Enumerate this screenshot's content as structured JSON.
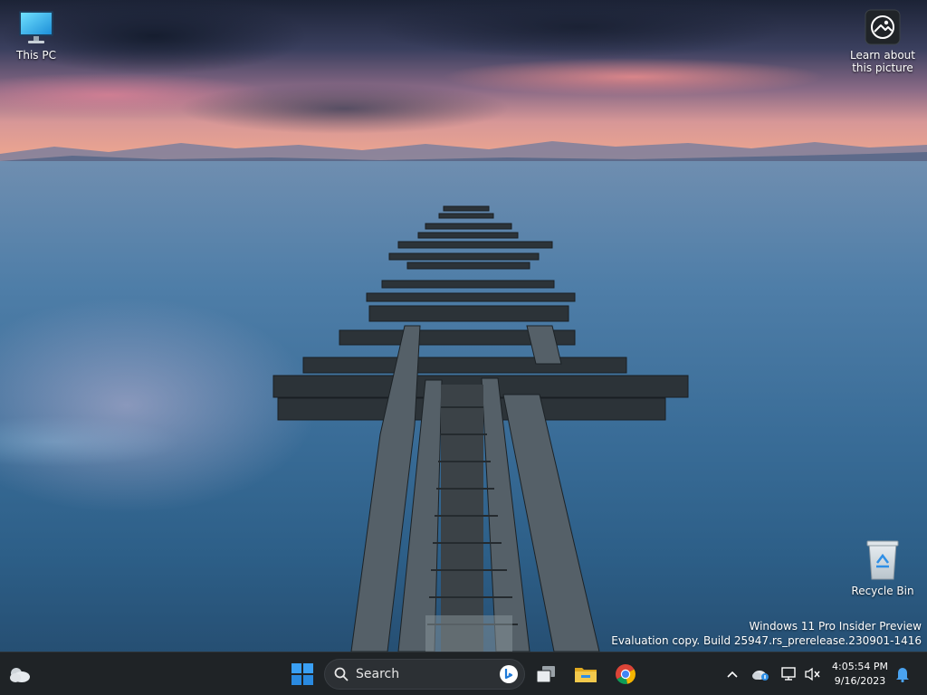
{
  "desktop": {
    "icons": [
      {
        "label": "This PC",
        "icon": "monitor-icon"
      },
      {
        "label": "Learn about this picture",
        "icon": "learn-about-picture-icon"
      },
      {
        "label": "Recycle Bin",
        "icon": "recycle-bin-icon"
      }
    ],
    "watermark": {
      "line1": "Windows 11 Pro Insider Preview",
      "line2": "Evaluation copy. Build 25947.rs_prerelease.230901-1416"
    }
  },
  "taskbar": {
    "widgets_icon": "weather-cloud-icon",
    "start_icon": "windows-start-icon",
    "search": {
      "label": "Search",
      "icon": "search-icon",
      "bing_icon": "bing-icon"
    },
    "pinned": [
      {
        "name": "task-view",
        "icon": "task-view-icon"
      },
      {
        "name": "file-explorer",
        "icon": "folder-icon"
      },
      {
        "name": "chrome",
        "icon": "chrome-icon"
      }
    ],
    "tray": [
      {
        "name": "show-hidden-icons",
        "icon": "chevron-up-icon"
      },
      {
        "name": "onedrive",
        "icon": "onedrive-icon"
      },
      {
        "name": "network",
        "icon": "network-icon"
      },
      {
        "name": "volume",
        "icon": "volume-muted-icon"
      }
    ],
    "clock": {
      "time": "4:05:54 PM",
      "date": "9/16/2023"
    },
    "notification_icon": "bell-icon"
  },
  "colors": {
    "taskbar_bg": "#1f2326",
    "accent_blue": "#2f8fe6",
    "folder_yellow": "#f2c94c"
  }
}
